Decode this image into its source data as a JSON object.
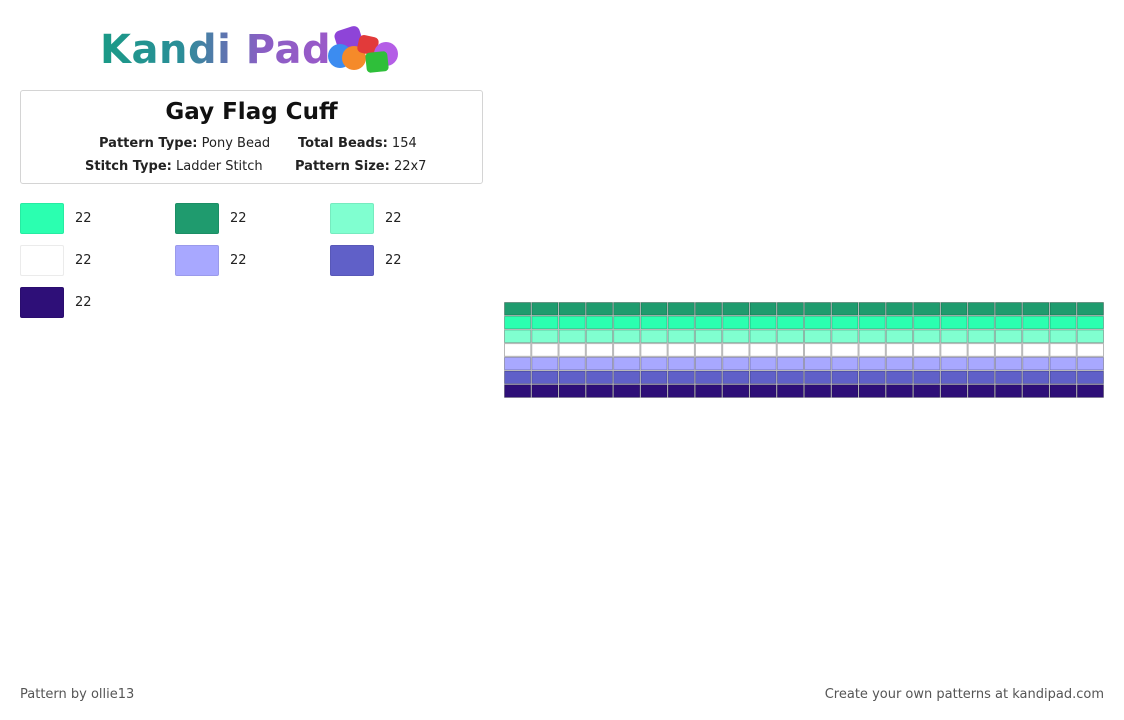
{
  "logo": {
    "text": "Kandi Pad"
  },
  "pattern": {
    "title": "Gay Flag Cuff",
    "type_label": "Pattern Type:",
    "type_value": "Pony Bead",
    "beads_label": "Total Beads:",
    "beads_value": "154",
    "stitch_label": "Stitch Type:",
    "stitch_value": "Ladder Stitch",
    "size_label": "Pattern Size:",
    "size_value": "22x7"
  },
  "colors": [
    {
      "hex": "#2bffb0",
      "count": "22"
    },
    {
      "hex": "#1f9b6e",
      "count": "22"
    },
    {
      "hex": "#80ffd0",
      "count": "22"
    },
    {
      "hex": "#ffffff",
      "count": "22"
    },
    {
      "hex": "#a8a8ff",
      "count": "22"
    },
    {
      "hex": "#6060c8",
      "count": "22"
    },
    {
      "hex": "#2e0f78",
      "count": "22"
    }
  ],
  "bead_grid": {
    "columns": 22,
    "rows": [
      "#1f9b6e",
      "#2bffb0",
      "#80ffd0",
      "#ffffff",
      "#a8a8ff",
      "#6060c8",
      "#2e0f78"
    ]
  },
  "footer": {
    "credit": "Pattern by ollie13",
    "cta": "Create your own patterns at kandipad.com"
  }
}
